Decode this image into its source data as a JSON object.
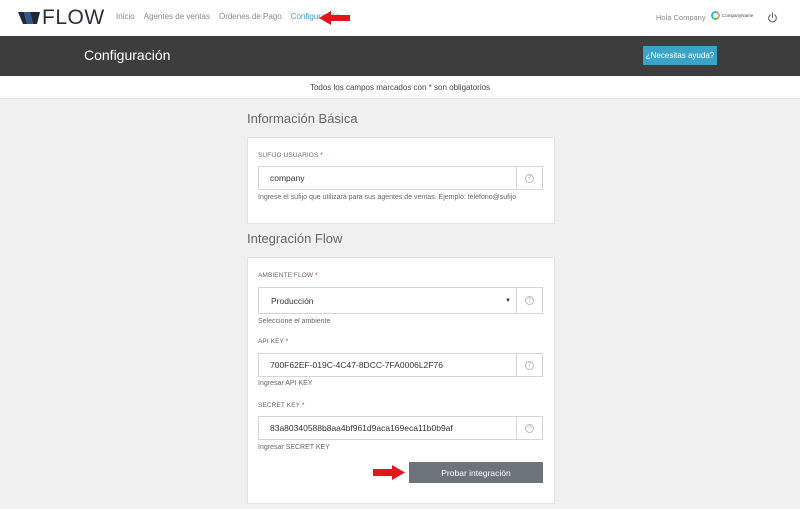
{
  "brand": {
    "logo_text": "FLOW"
  },
  "nav": {
    "items": [
      {
        "label": "Inicio"
      },
      {
        "label": "Agentes de ventas"
      },
      {
        "label": "Órdenes de Pago"
      },
      {
        "label": "Configuración",
        "active": true
      }
    ]
  },
  "user": {
    "greeting": "Hola Company",
    "company_logo_text": "CompanyName"
  },
  "header": {
    "title": "Configuración",
    "help_button": "¿Necesitas ayuda?"
  },
  "notice": "Todos los campos marcados con * son obligatorios",
  "sections": {
    "basic": {
      "title": "Información Básica",
      "sufijo": {
        "label": "SUFIJO USUARIOS",
        "required": "*",
        "value": "company",
        "help": "Ingrese el sufijo que utilizará para sus agentes de ventas. Ejemplo: telefono@sufijo"
      }
    },
    "integration": {
      "title": "Integración Flow",
      "ambiente": {
        "label": "AMBIENTE FLOW",
        "required": "*",
        "value": "Producción",
        "help": "Seleccione el ambiente"
      },
      "api_key": {
        "label": "API KEY",
        "required": "*",
        "value": "700F62EF-019C-4C47-8DCC-7FA0006L2F76",
        "help": "Ingresar API KEY"
      },
      "secret_key": {
        "label": "SECRET KEY",
        "required": "*",
        "value": "83a80340588b8aa4bf961d9aca169eca11b0b9af",
        "help": "Ingresar SECRET KEY"
      },
      "test_button": "Probar integración"
    }
  },
  "colors": {
    "accent": "#3aa3c8",
    "header_bg": "#3d3d3d",
    "annotation_arrow": "#e8141c",
    "button_gray": "#6c7379"
  },
  "icons": [
    "flow-logo-icon",
    "company-logo-icon",
    "power-icon",
    "question-icon",
    "caret-down-icon",
    "annotation-arrow-icon"
  ]
}
